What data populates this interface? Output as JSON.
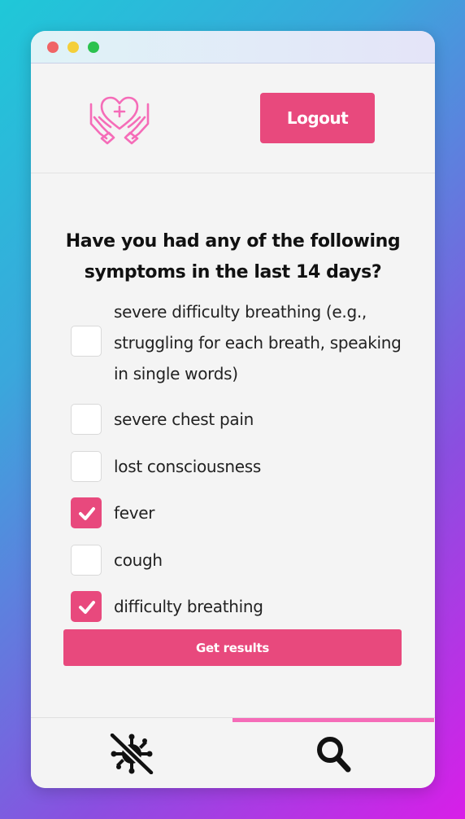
{
  "header": {
    "logo_icon": "hands-heart-care-icon",
    "logout_label": "Logout"
  },
  "question": "Have you had any of the following symptoms in the last 14 days?",
  "symptoms": [
    {
      "label": "severe difficulty breathing (e.g., struggling for each breath, speaking in single words)",
      "checked": false
    },
    {
      "label": "severe chest pain",
      "checked": false
    },
    {
      "label": "lost consciousness",
      "checked": false
    },
    {
      "label": "fever",
      "checked": true
    },
    {
      "label": "cough",
      "checked": false
    },
    {
      "label": "difficulty breathing",
      "checked": true
    }
  ],
  "submit_label": "Get results",
  "nav": {
    "tabs": [
      {
        "icon": "virus-slash-icon",
        "active": false
      },
      {
        "icon": "search-icon",
        "active": true
      }
    ]
  },
  "colors": {
    "accent": "#e8497d",
    "active_tab": "#f56cb8",
    "logo": "#f56cb8"
  }
}
